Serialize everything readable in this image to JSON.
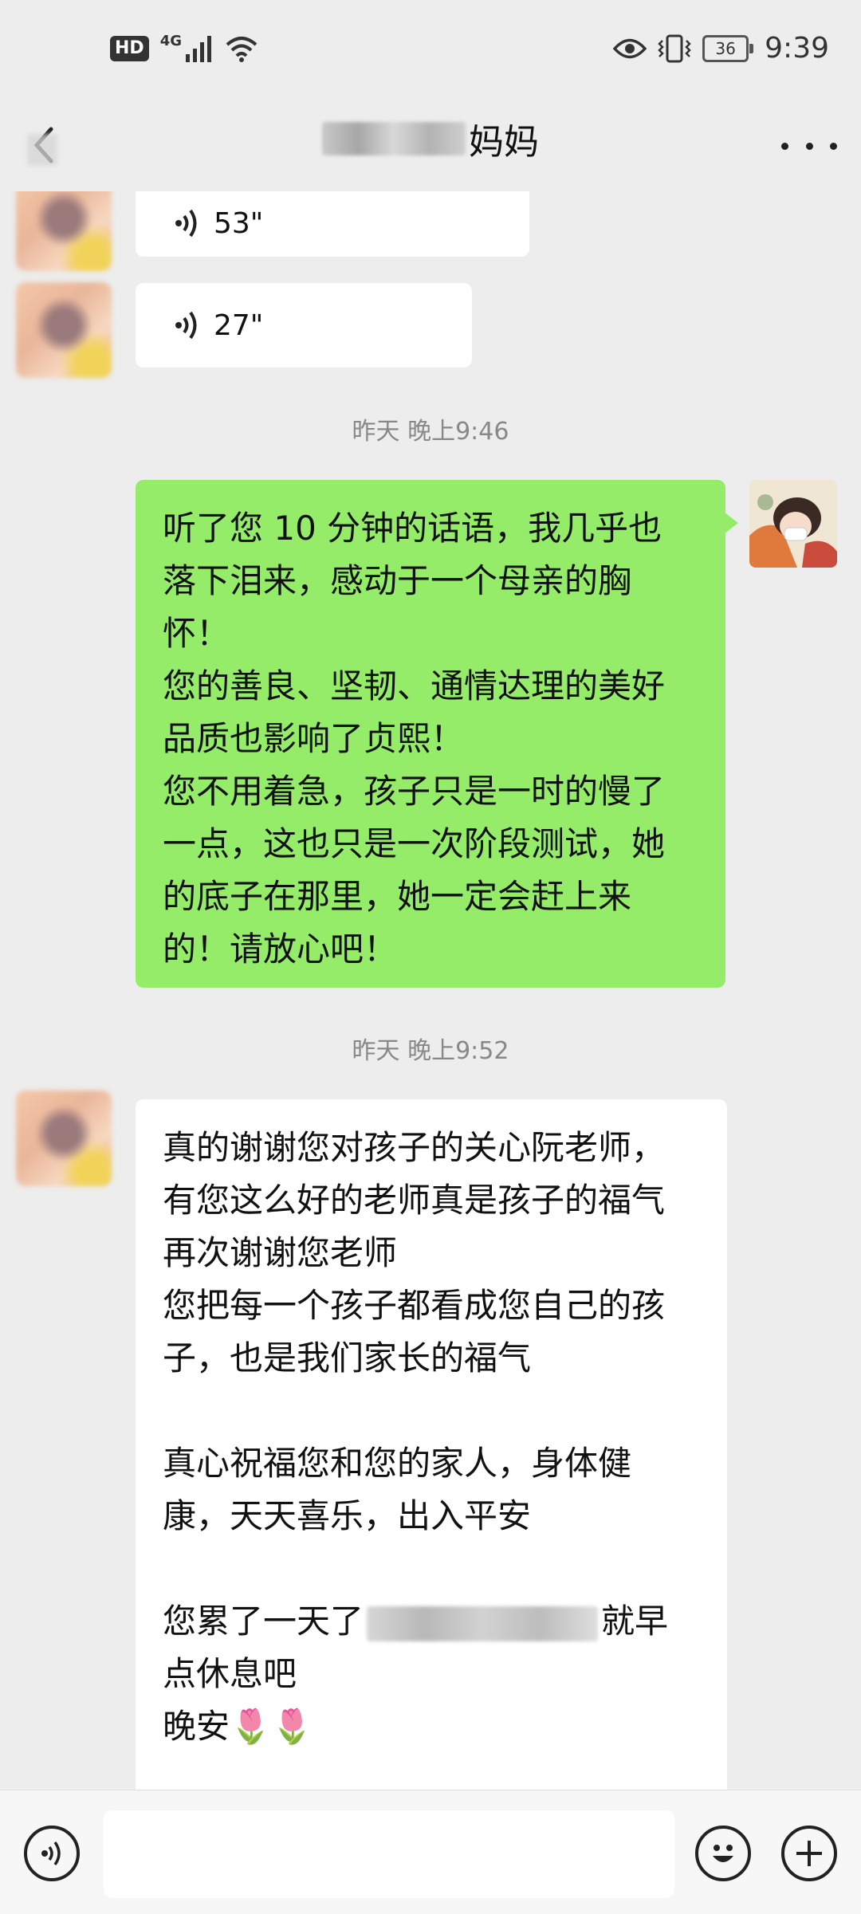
{
  "status_bar": {
    "hd": "HD",
    "net": "4G",
    "battery": "36",
    "time": "9:39"
  },
  "header": {
    "title": "妈妈"
  },
  "voice_messages": [
    {
      "duration": "53\""
    },
    {
      "duration": "27\""
    }
  ],
  "timestamps": [
    "昨天 晚上9:46",
    "昨天 晚上9:52"
  ],
  "sent_message": {
    "lines": [
      "听了您 10 分钟的话语，我几乎也",
      "落下泪来，感动于一个母亲的胸",
      "怀！",
      "您的善良、坚韧、通情达理的美好",
      "品质也影响了贞熙！",
      "您不用着急，孩子只是一时的慢了",
      "一点，这也只是一次阶段测试，她",
      "的底子在那里，她一定会赶上来",
      "的！请放心吧！"
    ]
  },
  "received_message": {
    "lines": [
      "真的谢谢您对孩子的关心阮老师，",
      "有您这么好的老师真是孩子的福气",
      "再次谢谢您老师",
      "您把每一个孩子都看成您自己的孩",
      "子，也是我们家长的福气",
      "",
      "真心祝福您和您的家人，身体健",
      "康，天天喜乐，出入平安",
      ""
    ],
    "line_blur_prefix": "您累了一天了",
    "line_blur_suffix": "就早",
    "tail_lines": [
      "点休息吧",
      "晚安🌷🌷"
    ]
  },
  "colors": {
    "background": "#ededed",
    "sent_bubble": "#95ec69",
    "received_bubble": "#ffffff"
  }
}
